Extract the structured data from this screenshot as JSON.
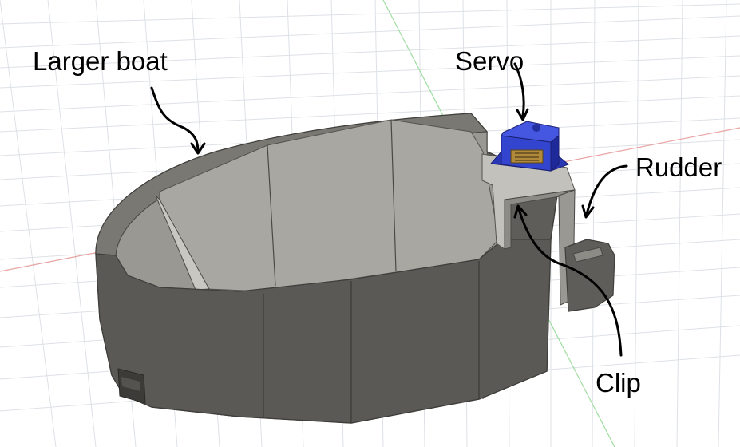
{
  "labels": {
    "larger_boat": "Larger boat",
    "servo": "Servo",
    "rudder": "Rudder",
    "clip": "Clip"
  },
  "colors": {
    "background": "#ffffff",
    "grid": "#d9dde2",
    "axis_red": "#e9a2a2",
    "axis_green": "#9fdca0",
    "hull_outer": "#5e5c58",
    "hull_inner": "#8e8c87",
    "hull_rim": "#6c6a66",
    "servo_blue": "#2f3fc9",
    "arrow": "#000000"
  }
}
